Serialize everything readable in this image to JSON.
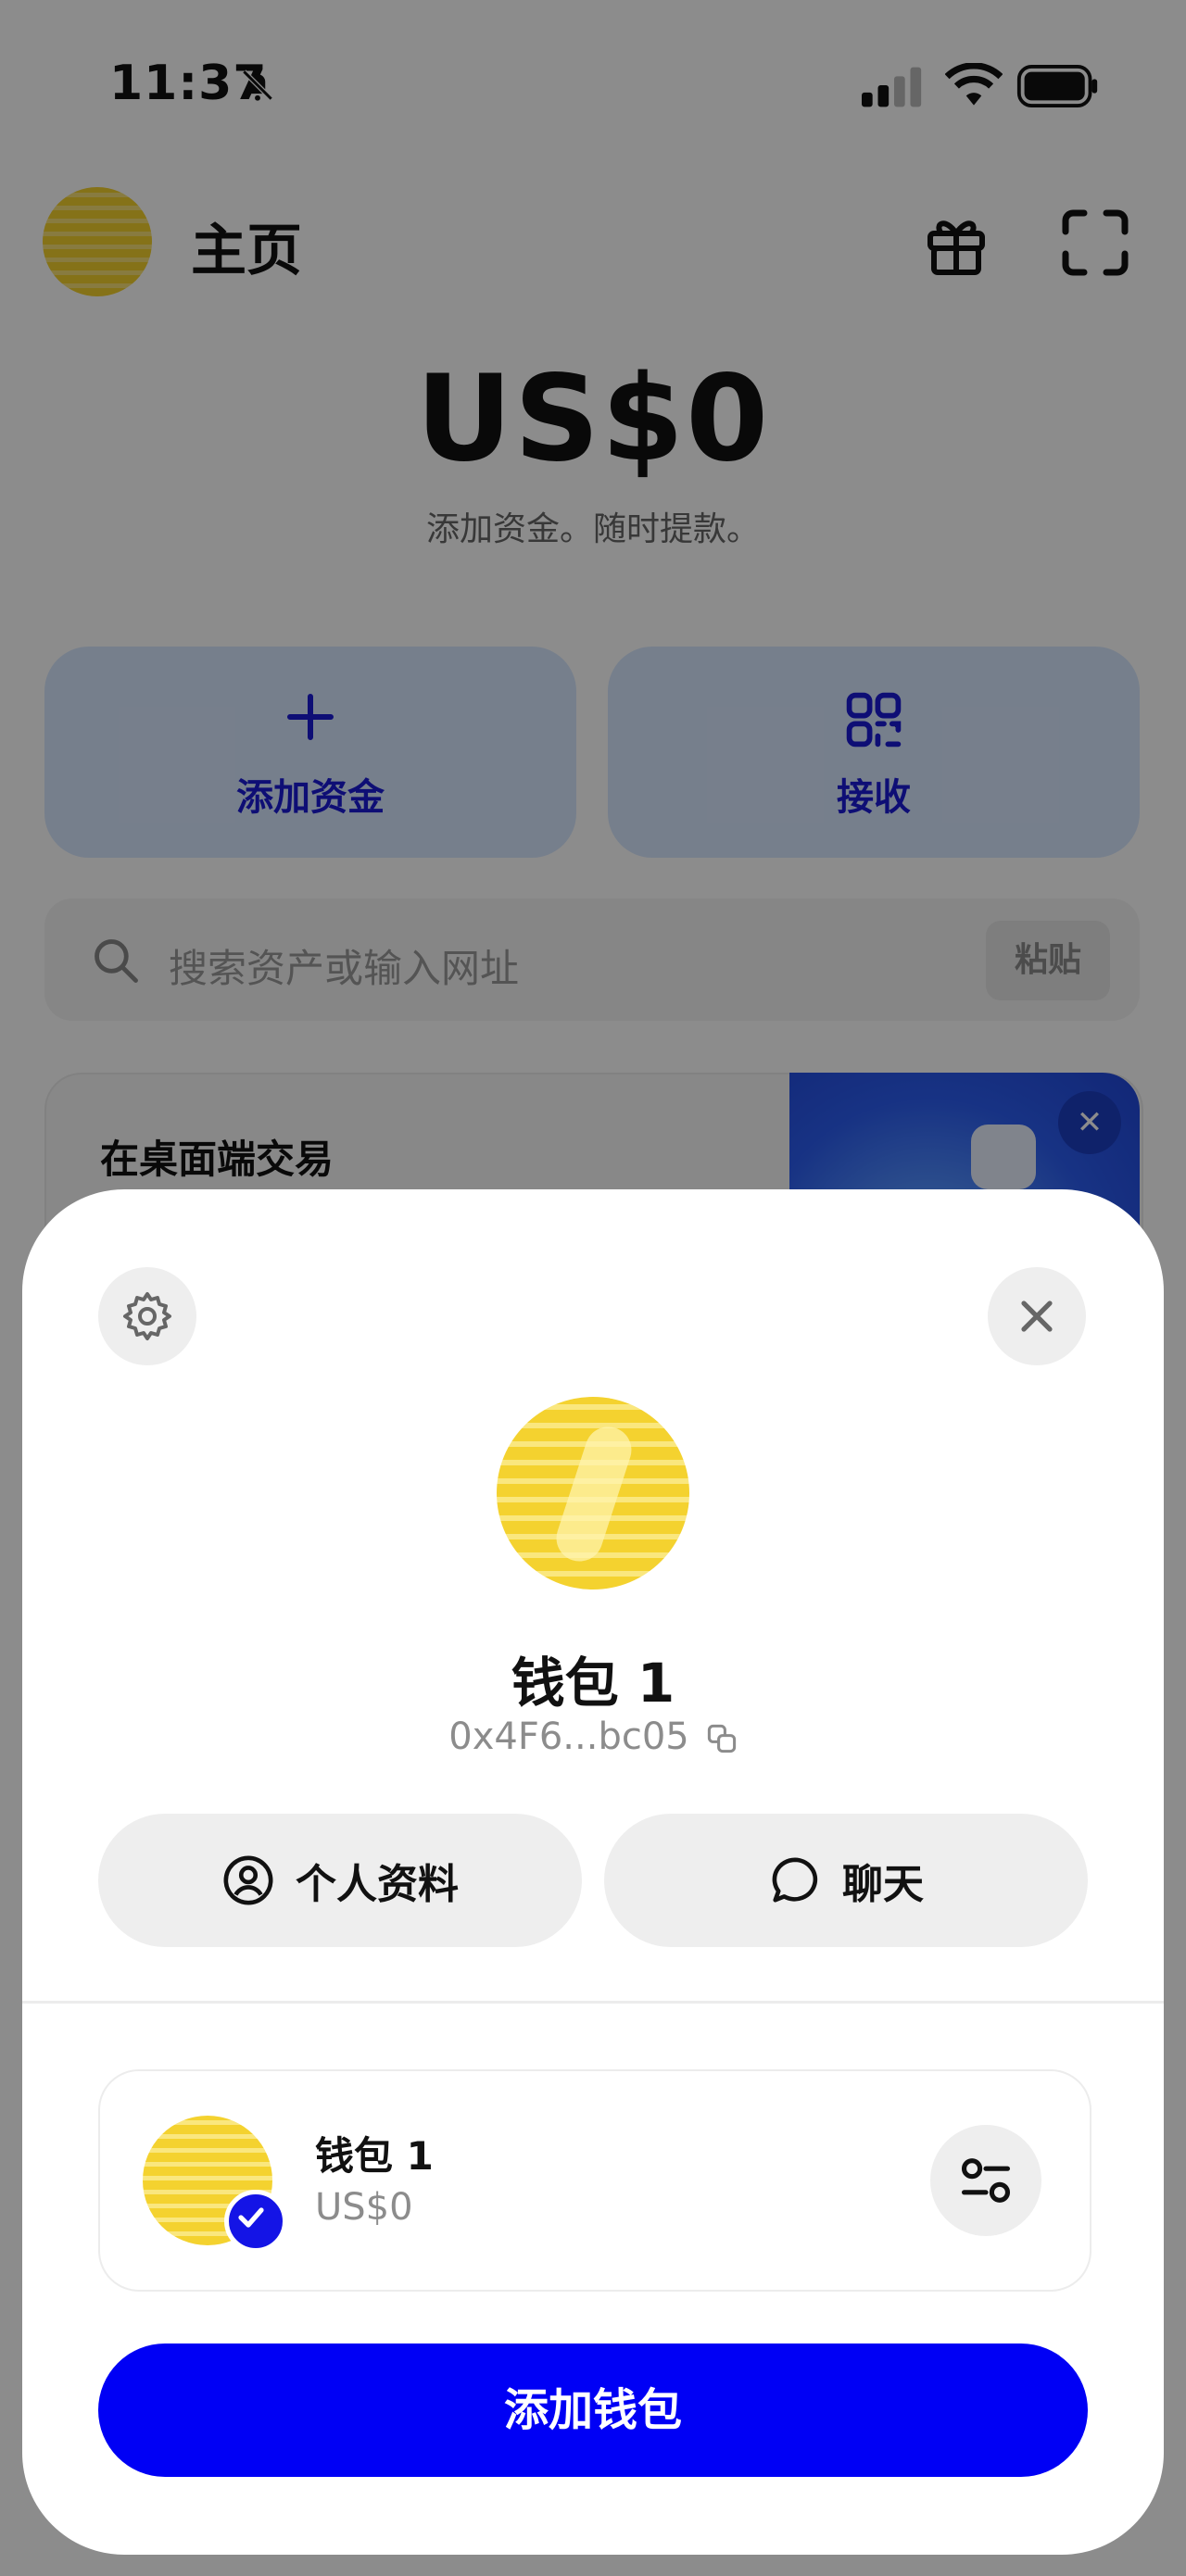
{
  "status_bar": {
    "time": "11:37"
  },
  "header": {
    "title": "主页"
  },
  "balance": {
    "amount": "US$0",
    "subtitle": "添加资金。随时提款。"
  },
  "actions": [
    {
      "label": "添加资金",
      "icon": "plus-icon"
    },
    {
      "label": "接收",
      "icon": "qr-receive-icon"
    }
  ],
  "search": {
    "placeholder": "搜索资产或输入网址",
    "paste_label": "粘贴"
  },
  "promo": {
    "title": "在桌面端交易"
  },
  "sheet": {
    "wallet_name": "钱包 1",
    "address": "0x4F6...bc05",
    "buttons": {
      "profile": "个人资料",
      "chat": "聊天"
    },
    "wallet_list": [
      {
        "name": "钱包 1",
        "balance": "US$0",
        "selected": true
      }
    ],
    "add_wallet_label": "添加钱包"
  },
  "colors": {
    "accent": "#0000F5",
    "action_card_bg": "#D8E8FF",
    "action_text": "#1A1AD6",
    "avatar_yellow": "#F4D22F"
  }
}
